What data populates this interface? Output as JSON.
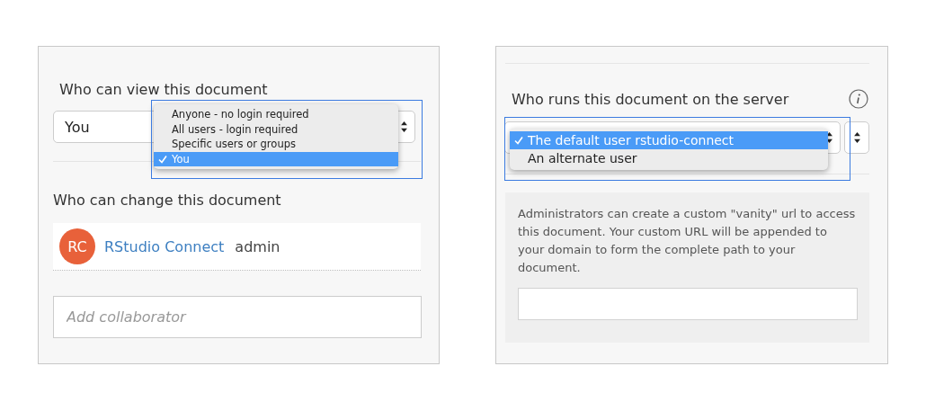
{
  "left_panel": {
    "view_heading": "Who can view this document",
    "view_select": {
      "value": "You",
      "options": [
        {
          "label": "Anyone - no login required",
          "selected": false
        },
        {
          "label": "All users - login required",
          "selected": false
        },
        {
          "label": "Specific users or groups",
          "selected": false
        },
        {
          "label": "You",
          "selected": true
        }
      ]
    },
    "change_heading": "Who can change this document",
    "collaborators": [
      {
        "initials": "RC",
        "name": "RStudio Connect",
        "role": "admin"
      }
    ],
    "add_field": {
      "placeholder": "Add collaborator"
    }
  },
  "right_panel": {
    "run_heading": "Who runs this document on the server",
    "run_select": {
      "options": [
        {
          "label": "The default user rstudio-connect",
          "selected": true
        },
        {
          "label": "An alternate user",
          "selected": false
        }
      ]
    },
    "vanity": {
      "description": "Administrators can create a custom \"vanity\" url to access this document. Your custom URL will be appended to your domain to form the complete path to your document."
    }
  }
}
